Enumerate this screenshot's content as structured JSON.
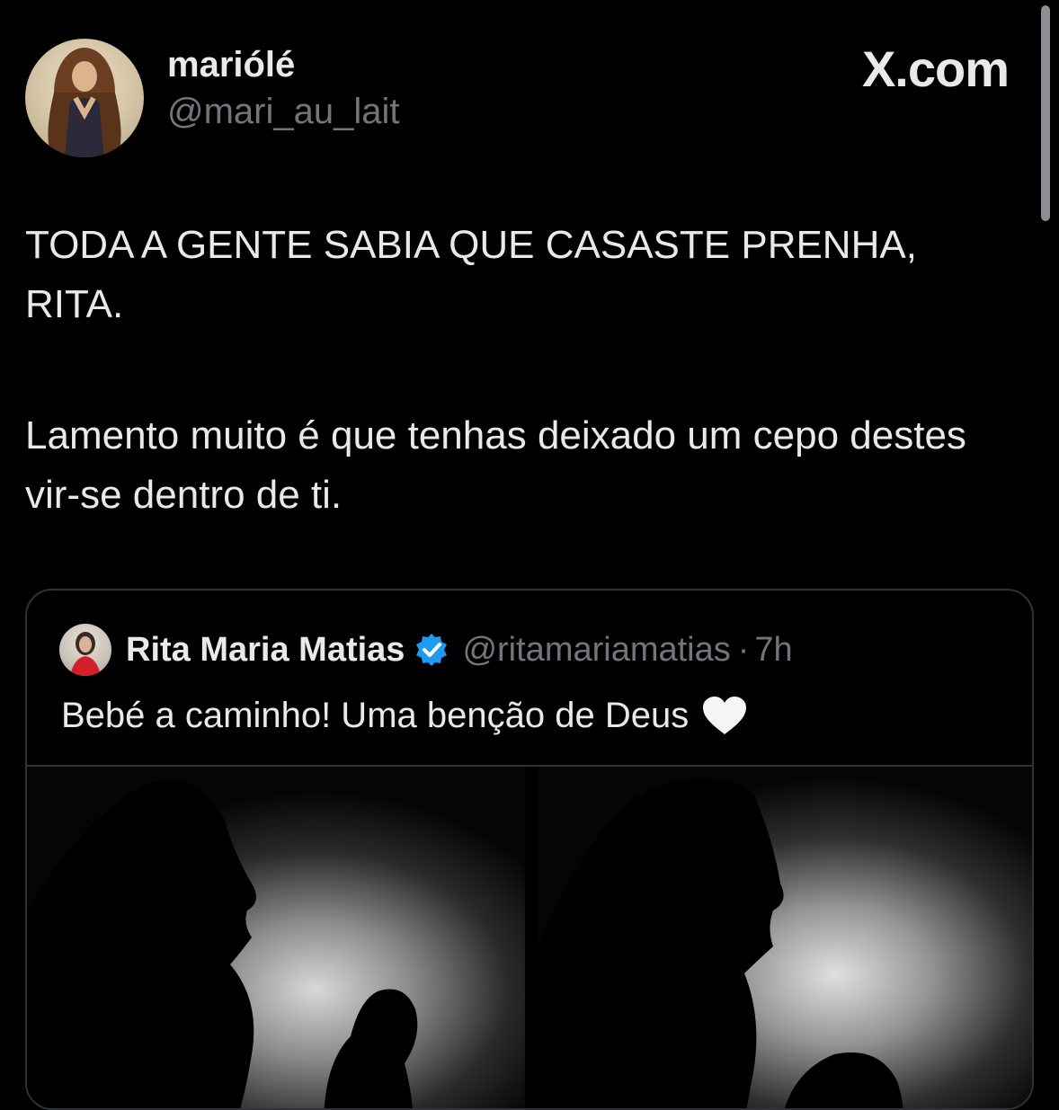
{
  "tweet": {
    "display_name": "mariólé",
    "handle": "@mari_au_lait",
    "site_label": "X.com",
    "paragraphs": [
      "TODA A GENTE SABIA QUE CASASTE PRENHA, RITA.",
      "Lamento muito é que tenhas deixado um cepo destes vir-se dentro de ti."
    ]
  },
  "quoted_tweet": {
    "display_name": "Rita Maria Matias",
    "handle": "@ritamariamatias",
    "separator": "·",
    "time": "7h",
    "text": "Bebé a caminho! Uma benção de Deus",
    "verified_color": "#1d9bf0"
  },
  "colors": {
    "background": "#000000",
    "text_primary": "#e7e9ea",
    "text_secondary": "#71767b",
    "border": "#2f3336"
  }
}
